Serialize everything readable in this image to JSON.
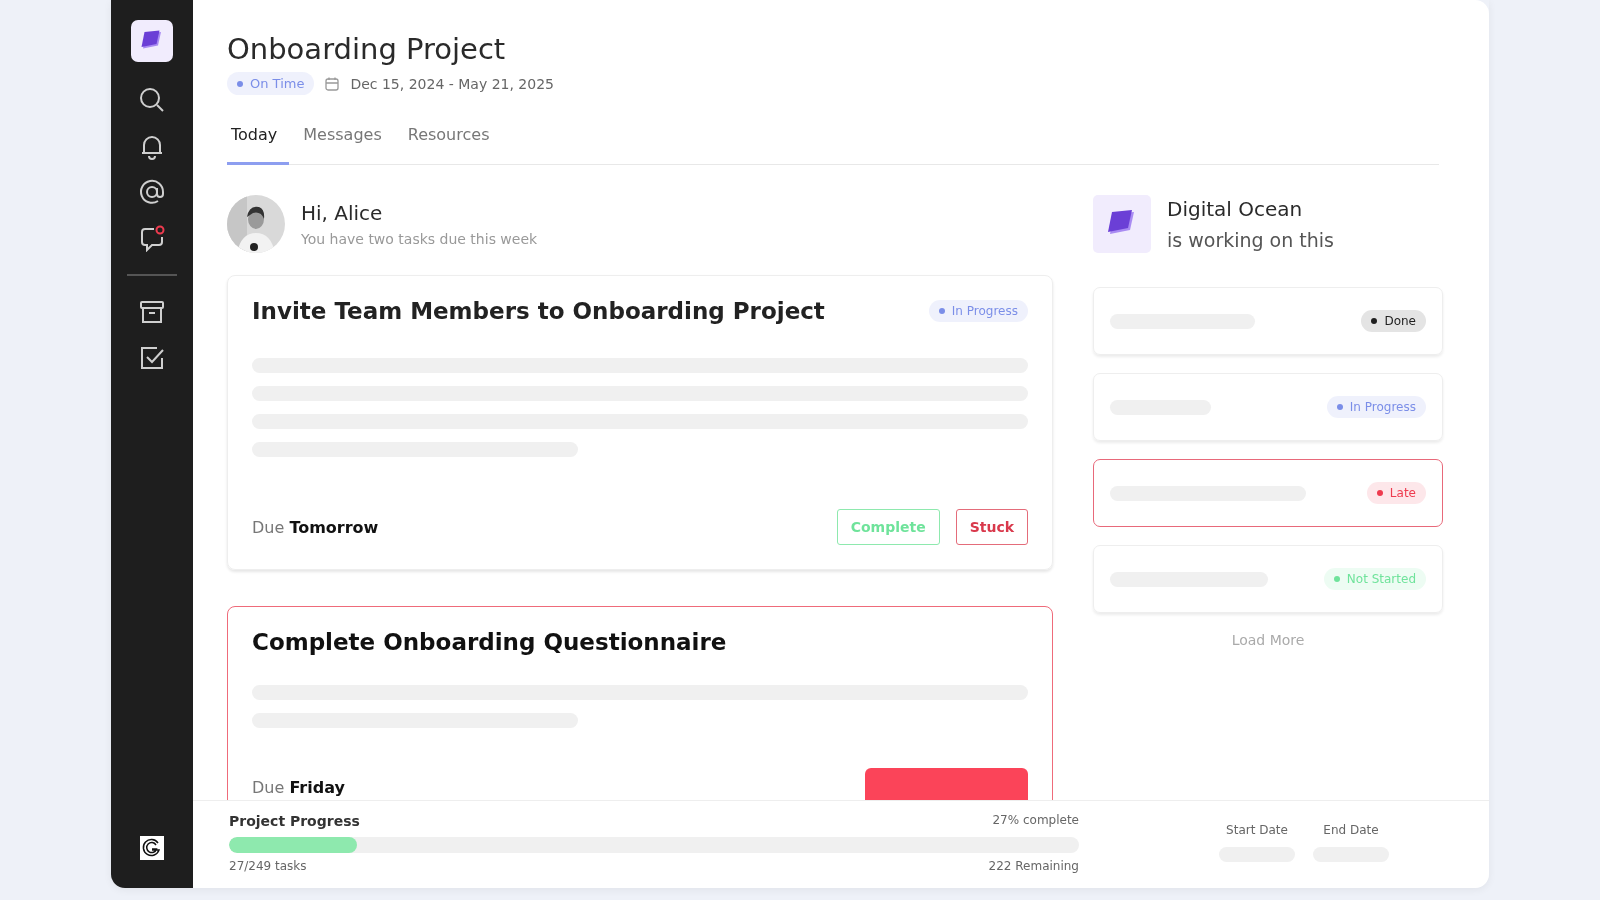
{
  "sidebar": {
    "chat_unread": true
  },
  "project": {
    "title": "Onboarding Project",
    "status": {
      "label": "On Time",
      "color": "#7b8ee8"
    },
    "date_range": "Dec 15, 2024 - May 21, 2025"
  },
  "tabs": [
    {
      "label": "Today",
      "selected": true
    },
    {
      "label": "Messages",
      "selected": false
    },
    {
      "label": "Resources",
      "selected": false
    }
  ],
  "greeting": {
    "title": "Hi, Alice",
    "subtitle": "You have two tasks due this week"
  },
  "tasks": [
    {
      "title": "Invite Team Members to Onboarding Project",
      "late": false,
      "kind": "long",
      "status": {
        "label": "In Progress",
        "color": "#7b8ee8"
      },
      "due_label": "Due",
      "due_value": "Tomorrow",
      "buttons": [
        {
          "label": "Complete",
          "kind": "outline-success"
        },
        {
          "label": "Stuck",
          "kind": "outline-danger"
        }
      ]
    },
    {
      "title": "Complete Onboarding Questionnaire",
      "late": true,
      "kind": "short",
      "due_label": "Due",
      "due_value": "Friday",
      "buttons": [
        {
          "kind": "solid-danger"
        }
      ]
    }
  ],
  "team": {
    "name": "Digital Ocean",
    "subtitle": "is working on this",
    "items": [
      {
        "status": "Done",
        "color": "#1f1f1f",
        "late": false
      },
      {
        "status": "In Progress",
        "color": "#7b8ee8",
        "late": false
      },
      {
        "status": "Late",
        "color": "#ee3b4f",
        "late": true
      },
      {
        "status": "Not Started",
        "color": "#6fe39b",
        "late": false
      }
    ],
    "load_more": "Load More"
  },
  "progress": {
    "title": "Project Progress",
    "percent": "27% complete",
    "level": 0.15,
    "tasks": "27/249 tasks",
    "remaining": "222 Remaining",
    "dates": [
      "Start Date",
      "End Date"
    ]
  }
}
